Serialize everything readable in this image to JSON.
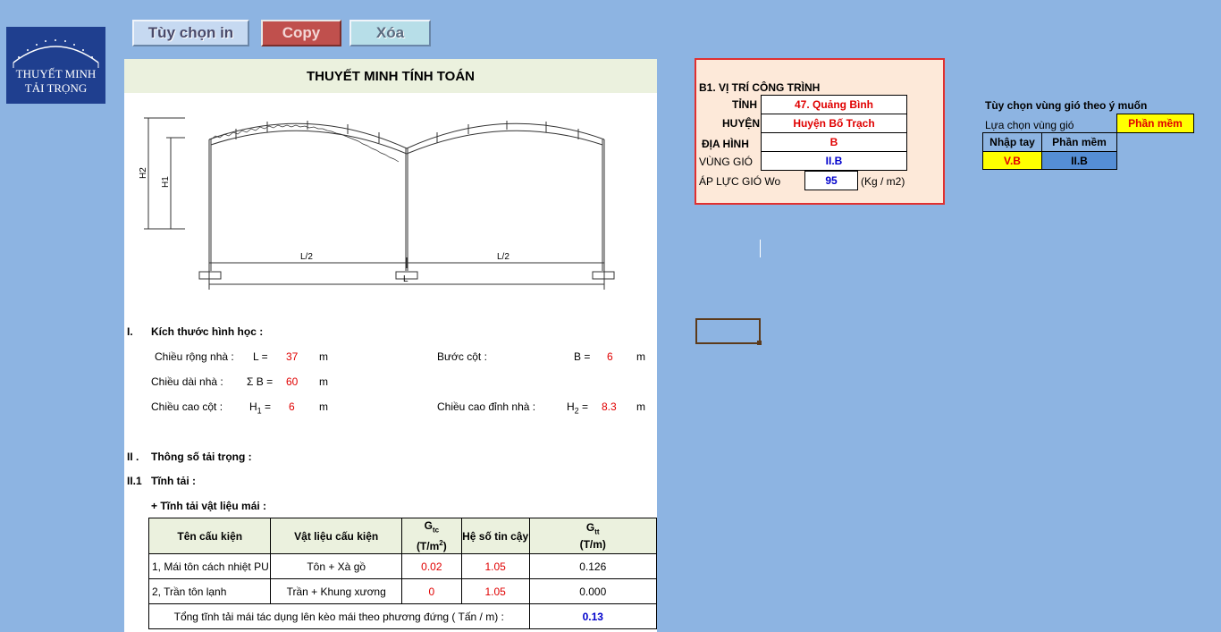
{
  "logo": {
    "line1": "THUYẾT MINH",
    "line2": "TẢI TRỌNG"
  },
  "toolbar": {
    "print_label": "Tùy chọn in",
    "copy_label": "Copy",
    "clear_label": "Xóa"
  },
  "report": {
    "title": "THUYẾT MINH TÍNH TOÁN",
    "diagram": {
      "h2": "H2",
      "h1": "H1",
      "half_span_left": "L/2",
      "half_span_right": "L/2",
      "span": "L"
    },
    "section1": {
      "heading_num": "I.",
      "heading": "Kích thước hình học :",
      "width_label": "Chiều rộng nhà :",
      "width_sym": "L =",
      "width_val": "37",
      "width_unit": "m",
      "bay_label": "Bước cột :",
      "bay_sym": "B =",
      "bay_val": "6",
      "bay_unit": "m",
      "length_label": "Chiều dài nhà :",
      "length_sym": "Σ B =",
      "length_val": "60",
      "length_unit": "m",
      "colh_label": "Chiều cao cột :",
      "colh_sym": "H",
      "colh_sub": "1",
      "colh_eq": " =",
      "colh_val": "6",
      "colh_unit": "m",
      "roofh_label": "Chiều cao đỉnh nhà :",
      "roofh_sym": "H",
      "roofh_sub": "2",
      "roofh_eq": " =",
      "roofh_val": "8.3",
      "roofh_unit": "m"
    },
    "section2": {
      "heading_num": "II .",
      "heading": "Thông số tải trọng :",
      "sub_num": "II.1",
      "sub_heading": "Tĩnh tải :",
      "roof_heading": "+ Tĩnh tải vật liệu mái :"
    },
    "load_table": {
      "headers": {
        "name": "Tên cấu kiện",
        "material": "Vật liệu cấu kiện",
        "gtc": "G",
        "gtc_sub": "tc",
        "gtc_unit": "(T/m",
        "gtc_sup": "2",
        "gtc_close": ")",
        "factor": "Hệ số tin cậy",
        "gtt": "G",
        "gtt_sub": "tt",
        "gtt_unit": "(T/m)"
      },
      "rows": [
        {
          "name": "1, Mái tôn cách nhiệt PU",
          "material": "Tôn + Xà gồ",
          "gtc": "0.02",
          "factor": "1.05",
          "gtt": "0.126"
        },
        {
          "name": "2, Trần tôn lạnh",
          "material": "Trần + Khung xương",
          "gtc": "0",
          "factor": "1.05",
          "gtt": "0.000"
        }
      ],
      "total_label": "Tổng tĩnh tải mái tác dụng lên kèo mái theo phương đứng ( Tấn / m) :",
      "total_val": "0.13"
    }
  },
  "site": {
    "heading": "B1. VỊ TRÍ CÔNG TRÌNH",
    "province_label": "TỈNH",
    "province_val": "47. Quảng Bình",
    "district_label": "HUYỆN",
    "district_val": "Huyện Bố Trạch",
    "terrain_label": "ĐỊA HÌNH",
    "terrain_val": "B",
    "zone_label": "VÙNG GIÓ",
    "zone_val": "II.B",
    "pressure_label": "ÁP LỰC GIÓ Wo",
    "pressure_val": "95",
    "pressure_unit": "(Kg / m2)"
  },
  "wind_option": {
    "title": "Tùy chọn vùng gió theo ý muốn",
    "choose_label": "Lựa chọn vùng gió",
    "choose_val": "Phần mềm",
    "manual_label": "Nhập tay",
    "software_label": "Phần mềm",
    "manual_val": "V.B",
    "software_val": "II.B"
  },
  "colors": {
    "background": "#8DB4E2",
    "report_header": "#EBF1DE",
    "site_box": "#FDE9D9",
    "accent_red": "#E00000",
    "accent_blue": "#0000CC"
  }
}
